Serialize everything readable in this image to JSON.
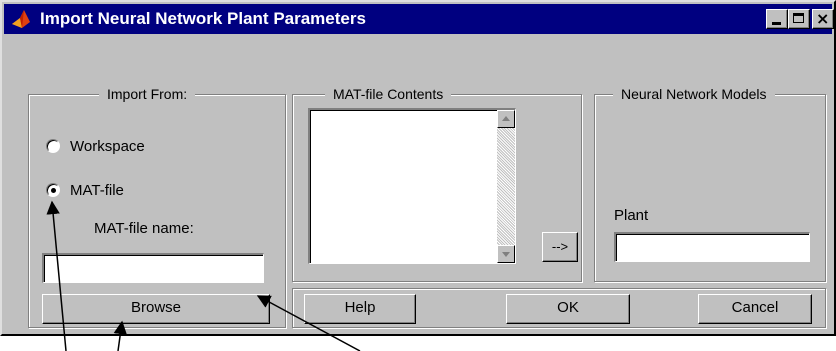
{
  "window": {
    "title": "Import Neural Network Plant Parameters",
    "title_bar_color": "#000080",
    "face_color": "#c0c0c0",
    "controls": {
      "minimize_icon": "minimize-icon",
      "maximize_icon": "maximize-icon",
      "close_icon": "close-icon",
      "close_glyph": "×"
    },
    "app_icon": "matlab-logo-icon"
  },
  "import_from": {
    "legend": "Import From:",
    "options": [
      {
        "label": "Workspace",
        "selected": false
      },
      {
        "label": "MAT-file",
        "selected": true
      }
    ],
    "matfile_name_label": "MAT-file name:",
    "matfile_name_value": "",
    "browse_label": "Browse"
  },
  "matfile_contents": {
    "legend": "MAT-file Contents",
    "items": [],
    "transfer_button_label": "-->"
  },
  "models": {
    "legend": "Neural Network Models",
    "plant_label": "Plant",
    "plant_value": ""
  },
  "buttons": {
    "help": "Help",
    "ok": "OK",
    "cancel": "Cancel"
  }
}
